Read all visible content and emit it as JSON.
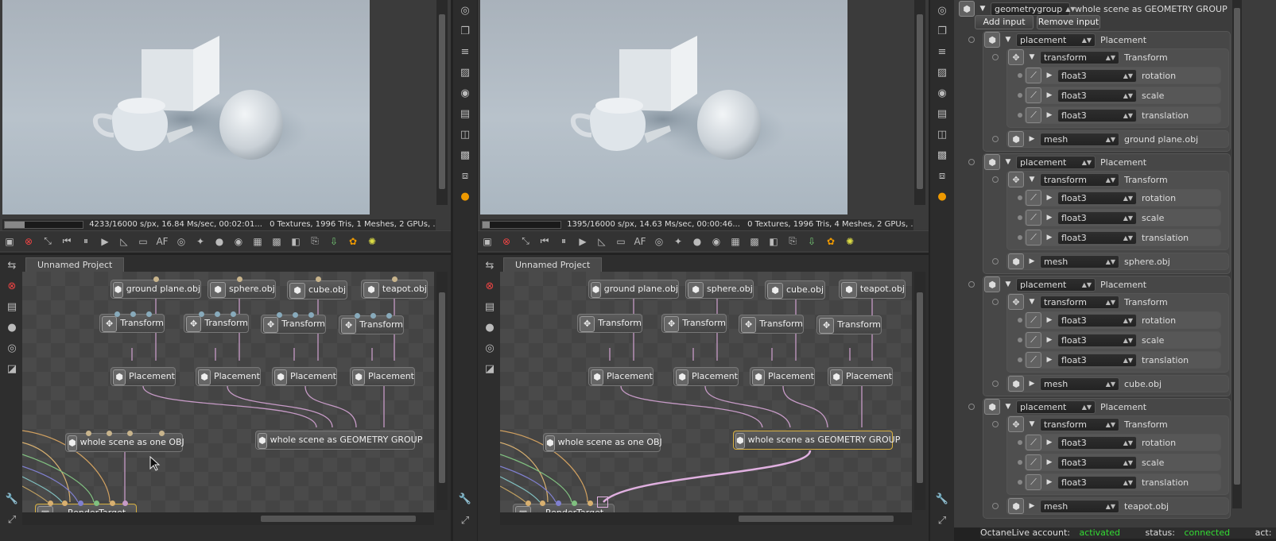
{
  "left_viewer": {
    "status_text": "4233/16000 s/px, 16.84 Ms/sec, 00:02:01...",
    "scene_stats": "0 Textures, 1996 Tris, 1 Meshes, 2 GPUs, ..."
  },
  "right_viewer": {
    "status_text": "1395/16000 s/px, 14.63 Ms/sec, 00:00:46...",
    "scene_stats": "0 Textures, 1996 Tris, 4 Meshes, 2 GPUs, ..."
  },
  "left_graph": {
    "tab": "Unnamed Project",
    "nodes": {
      "mesh1": "ground plane.obj",
      "mesh2": "sphere.obj",
      "mesh3": "cube.obj",
      "mesh4": "teapot.obj",
      "tr1": "Transform",
      "tr2": "Transform",
      "tr3": "Transform",
      "tr4": "Transform",
      "pl1": "Placement",
      "pl2": "Placement",
      "pl3": "Placement",
      "pl4": "Placement",
      "obj": "whole scene as one OBJ",
      "geo": "whole scene as GEOMETRY GROUP",
      "rt": "RenderTarget"
    }
  },
  "right_graph": {
    "tab": "Unnamed Project",
    "nodes": {
      "mesh1": "ground plane.obj",
      "mesh2": "sphere.obj",
      "mesh3": "cube.obj",
      "mesh4": "teapot.obj",
      "tr1": "Transform",
      "tr2": "Transform",
      "tr3": "Transform",
      "tr4": "Transform",
      "pl1": "Placement",
      "pl2": "Placement",
      "pl3": "Placement",
      "pl4": "Placement",
      "obj": "whole scene as one OBJ",
      "geo": "whole scene as GEOMETRY GROUP",
      "rt": "RenderTarget"
    }
  },
  "inspector": {
    "header_type": "geometrygroup",
    "header_name": "whole scene as GEOMETRY GROUP",
    "add_input": "Add input",
    "remove_input": "Remove input",
    "groups": [
      {
        "type": "placement",
        "name": "Placement",
        "tr_type": "transform",
        "tr_name": "Transform",
        "f": [
          {
            "type": "float3",
            "name": "rotation"
          },
          {
            "type": "float3",
            "name": "scale"
          },
          {
            "type": "float3",
            "name": "translation"
          }
        ],
        "mesh_type": "mesh",
        "mesh_name": "ground plane.obj"
      },
      {
        "type": "placement",
        "name": "Placement",
        "tr_type": "transform",
        "tr_name": "Transform",
        "f": [
          {
            "type": "float3",
            "name": "rotation"
          },
          {
            "type": "float3",
            "name": "scale"
          },
          {
            "type": "float3",
            "name": "translation"
          }
        ],
        "mesh_type": "mesh",
        "mesh_name": "sphere.obj"
      },
      {
        "type": "placement",
        "name": "Placement",
        "tr_type": "transform",
        "tr_name": "Transform",
        "f": [
          {
            "type": "float3",
            "name": "rotation"
          },
          {
            "type": "float3",
            "name": "scale"
          },
          {
            "type": "float3",
            "name": "translation"
          }
        ],
        "mesh_type": "mesh",
        "mesh_name": "cube.obj"
      },
      {
        "type": "placement",
        "name": "Placement",
        "tr_type": "transform",
        "tr_name": "Transform",
        "f": [
          {
            "type": "float3",
            "name": "rotation"
          },
          {
            "type": "float3",
            "name": "scale"
          },
          {
            "type": "float3",
            "name": "translation"
          }
        ],
        "mesh_type": "mesh",
        "mesh_name": "teapot.obj"
      }
    ]
  },
  "footer": {
    "account_label": "OctaneLive account:",
    "account_value": "activated",
    "status_label": "status:",
    "status_value": "connected",
    "act_label": "act:"
  },
  "colors": {
    "accent_green": "#33dd33",
    "selected_border": "#d8b040",
    "wire_pink": "#c79bc7"
  }
}
